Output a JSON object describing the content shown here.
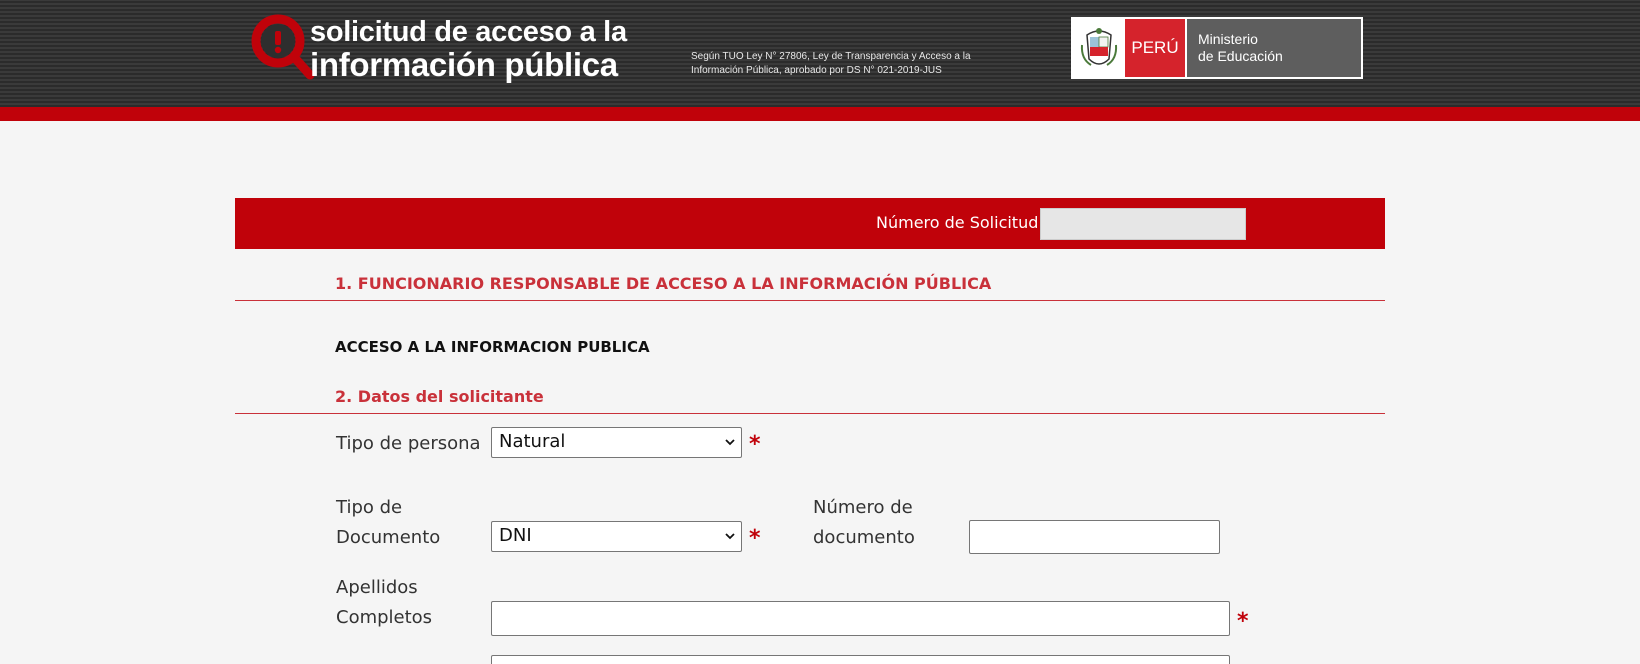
{
  "header": {
    "logo_line1": "solicitud de acceso a la",
    "logo_line2": "información pública",
    "law_text": "Según TUO Ley N° 27806, Ley de Transparencia y Acceso a la Información Pública, aprobado por DS N° 021-2019-JUS",
    "minedu_peru": "PERÚ",
    "minedu_ministry_line1": "Ministerio",
    "minedu_ministry_line2": "de Educación"
  },
  "request_bar": {
    "label": "Número de Solicitud",
    "value": ""
  },
  "section1": {
    "title": "1. FUNCIONARIO RESPONSABLE DE ACCESO A LA INFORMACIÓN PÚBLICA",
    "official": "ACCESO A LA INFORMACION PUBLICA"
  },
  "section2": {
    "title": "2. Datos del solicitante",
    "person_type_label": "Tipo de persona",
    "person_type_value": "Natural",
    "doc_type_label_line1": "Tipo de",
    "doc_type_label_line2": "Documento",
    "doc_type_value": "DNI",
    "doc_number_label_line1": "Número de",
    "doc_number_label_line2": "documento",
    "doc_number_value": "",
    "surnames_label_line1": "Apellidos",
    "surnames_label_line2": "Completos",
    "surnames_value": "",
    "required_mark": "*"
  },
  "colors": {
    "brand_red": "#c0020a",
    "section_red": "#c9313a",
    "header_dark": "#2b2b2b"
  },
  "icons": [
    "magnifier-info-icon",
    "peru-coat-of-arms-icon",
    "chevron-down-icon"
  ]
}
